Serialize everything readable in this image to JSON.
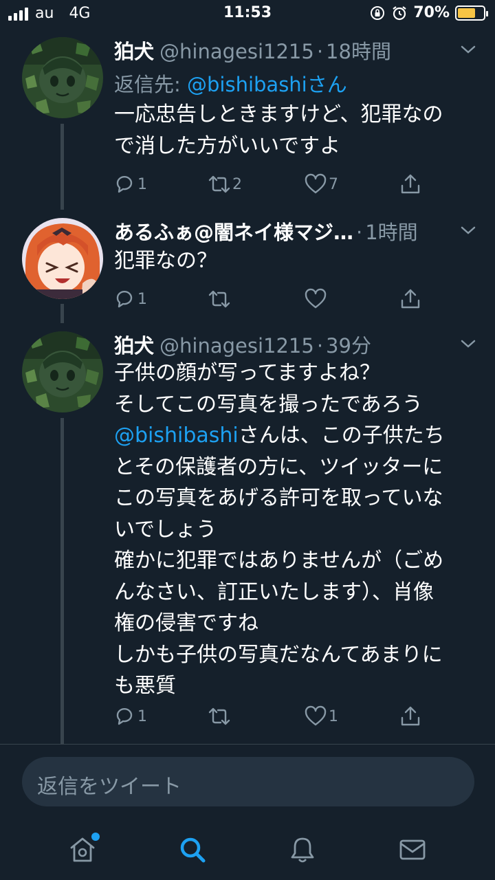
{
  "status_bar": {
    "carrier": "au",
    "network": "4G",
    "time": "11:53",
    "battery": "70%",
    "battery_level": 0.7,
    "battery_color": "#f6c445"
  },
  "tweets": [
    {
      "name": "狛犬",
      "handle": "@hinagesi1215",
      "time": "18時間",
      "reply_prefix": "返信先:",
      "reply_mention": "@bishibashiさん",
      "body_lines": [
        "一応忠告しときますけど、犯罪なの",
        "で消した方がいいですよ"
      ],
      "replies": "1",
      "retweets": "2",
      "likes": "7"
    },
    {
      "name": "あるふぁ@闇ネイ様マジ…",
      "time": "1時間",
      "body_lines": [
        "犯罪なの？"
      ],
      "replies": "1",
      "retweets": "",
      "likes": ""
    },
    {
      "name": "狛犬",
      "handle": "@hinagesi1215",
      "time": "39分",
      "body_lines": [
        "子供の顔が写ってますよね？",
        "そしてこの写真を撮ったであろう",
        "@bishibashi",
        "さんは、この子供たち",
        "とその保護者の方に、ツイッターに",
        "この写真をあげる許可を取っていな",
        "いでしょう",
        "確かに犯罪ではありませんが（ごめ",
        "んなさい、訂正いたします）、肖像",
        "権の侵害ですね",
        "しかも子供の写真だなんてあまりに",
        "も悪質"
      ],
      "replies": "1",
      "retweets": "",
      "likes": "1"
    }
  ],
  "compose": {
    "placeholder": "返信をツイート"
  },
  "tabbar": {
    "items": [
      "home-icon",
      "search-icon",
      "bell-icon",
      "mail-icon"
    ],
    "accent": "#1da1f2"
  },
  "theme": {
    "background": "#15202b",
    "secondary_text": "#8899a6",
    "link": "#1da1f2"
  }
}
